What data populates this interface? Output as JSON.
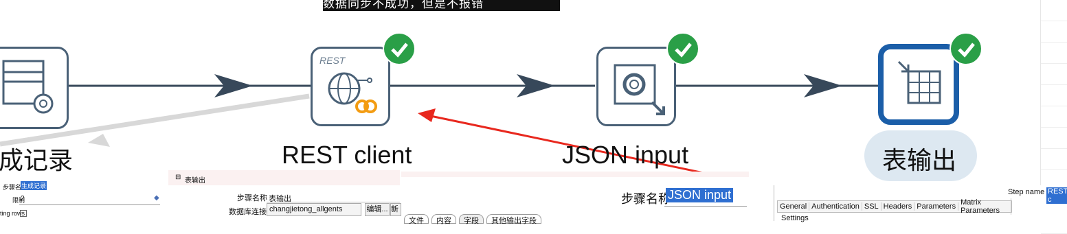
{
  "banner": "数据同步不成功，但是不报错",
  "steps": [
    {
      "label": "生成记录",
      "icon": "generate-rows-icon"
    },
    {
      "label": "REST client",
      "icon": "rest-client-icon",
      "badge": "rest-label"
    },
    {
      "label": "JSON input",
      "icon": "json-input-icon"
    },
    {
      "label": "表输出",
      "icon": "table-output-icon"
    }
  ],
  "rest_icon_text": "REST",
  "status_icon": "check-icon",
  "colors": {
    "check": "#2a9f47",
    "hop": "#37485a",
    "selected": "#1b5ea8",
    "annotation_arrow": "#e8281e"
  },
  "panel_generate": {
    "step_name_label": "步骤名称",
    "step_name_value": "生成记录",
    "limit_label": "限制",
    "limit_value": "2",
    "rows_label": "ting rows"
  },
  "panel_table_output": {
    "title": "表输出",
    "step_name_label": "步骤名称",
    "step_name_value": "表输出",
    "connection_label": "数据库连接",
    "connection_value": "changjietong_allgents",
    "edit_button": "编辑...",
    "new_button": "新"
  },
  "panel_json": {
    "step_name_label": "步骤名称",
    "step_name_value": "JSON input",
    "tabs": [
      "文件",
      "内容",
      "字段",
      "其他输出字段"
    ]
  },
  "panel_rest": {
    "step_name_label": "Step name",
    "step_name_value": "REST c",
    "tabs": [
      "General",
      "Authentication",
      "SSL",
      "Headers",
      "Parameters",
      "Matrix Parameters"
    ],
    "settings_label": "Settings"
  }
}
